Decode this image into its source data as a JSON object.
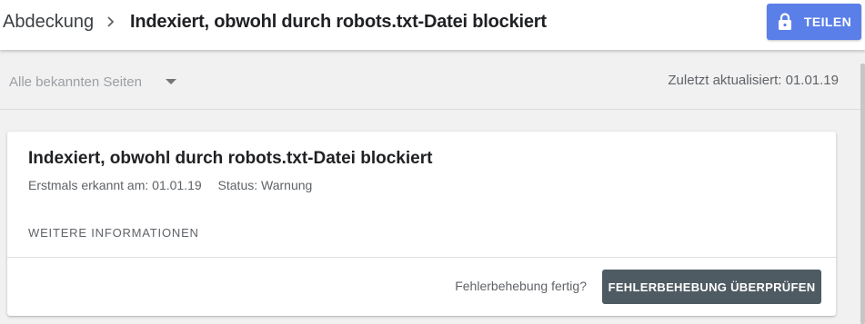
{
  "header": {
    "breadcrumb_parent": "Abdeckung",
    "breadcrumb_current": "Indexiert, obwohl durch robots.txt-Datei blockiert",
    "share_label": "TEILEN"
  },
  "filter": {
    "selected": "Alle bekannten Seiten",
    "last_updated": "Zuletzt aktualisiert: 01.01.19"
  },
  "issue_card": {
    "title": "Indexiert, obwohl durch robots.txt-Datei blockiert",
    "first_detected": "Erstmals erkannt am: 01.01.19",
    "status": "Status: Warnung",
    "more_info": "WEITERE INFORMATIONEN",
    "fix_question": "Fehlerbehebung fertig?",
    "validate_label": "FEHLERBEHEBUNG ÜBERPRÜFEN"
  },
  "icons": {
    "breadcrumb_separator": "chevron-right-icon",
    "share": "lock-icon",
    "filter_dropdown": "caret-down-icon"
  },
  "colors": {
    "share_button": "#5a7fe8",
    "validate_button": "#4f5b62",
    "page_background": "#f1f1f1"
  }
}
